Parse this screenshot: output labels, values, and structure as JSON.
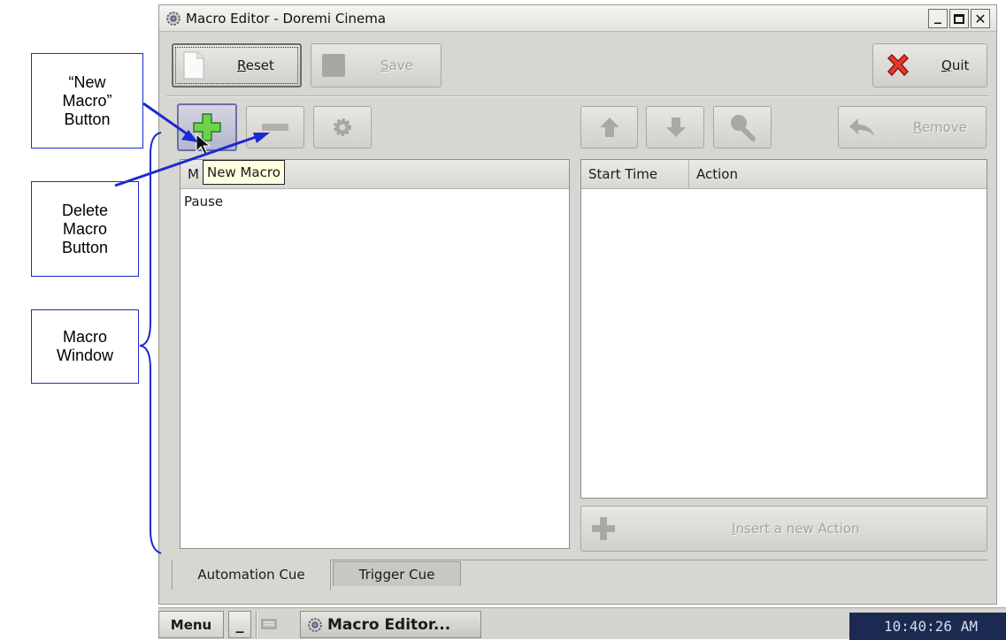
{
  "window": {
    "title": "Macro Editor - Doremi Cinema",
    "min_glyph": "_",
    "max_glyph": "☐",
    "close_glyph": "✕"
  },
  "toolbar": {
    "reset_label": "Reset",
    "reset_rest": "eset",
    "reset_mnemonic": "R",
    "save_label": "Save",
    "save_rest": "ave",
    "save_mnemonic": "S",
    "quit_label": "Quit",
    "quit_rest": "uit",
    "quit_mnemonic": "Q"
  },
  "macro_toolbar": {
    "tooltip": "New Macro"
  },
  "action_toolbar": {
    "remove_label": "Remove",
    "remove_rest": "emove",
    "remove_mnemonic": "R"
  },
  "macro_list": {
    "column_header_visible": "M",
    "items": [
      "Pause"
    ]
  },
  "action_table": {
    "columns": [
      "Start Time",
      "Action"
    ]
  },
  "insert_action": {
    "label": "Insert a new Action",
    "mnemonic": "I",
    "rest": "nsert a new Action"
  },
  "tabs": [
    {
      "label": "Automation Cue",
      "active": true
    },
    {
      "label": "Trigger Cue",
      "active": false
    }
  ],
  "taskbar": {
    "menu_label": "Menu",
    "minimize_label": "_",
    "task_label": "Macro Editor...",
    "clock": "10:40:26 AM"
  },
  "annotations": {
    "new_macro_callout": "“New\nMacro”\nButton",
    "delete_macro_callout": "Delete\nMacro\nButton",
    "macro_window_callout": "Macro\nWindow"
  },
  "colors": {
    "annotation_blue": "#1a2ad0",
    "window_bg": "#d8d6d1",
    "clock_bg": "#1c2a52"
  }
}
